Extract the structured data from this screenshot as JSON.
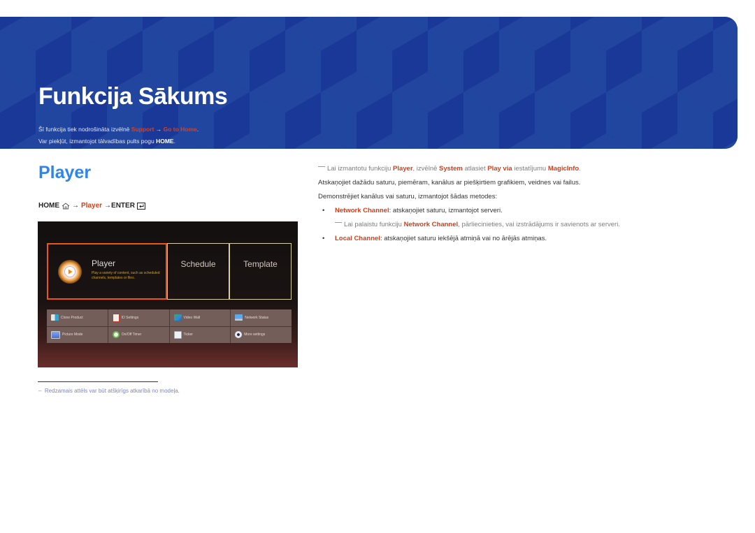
{
  "banner": {
    "title": "Funkcija Sākums",
    "line1": {
      "prefix": "Šī funkcija tiek nodrošināta izvēlnē ",
      "menu": "Support",
      "arrow": " → ",
      "item": "Go to Home",
      "suffix": "."
    },
    "line2": {
      "prefix": "Var piekļūt, izmantojot tālvadības pults pogu ",
      "key": "HOME",
      "suffix": "."
    }
  },
  "section": {
    "title": "Player",
    "path": {
      "home": "HOME",
      "home_icon": "home-icon",
      "arrow1": "→",
      "player": "Player",
      "arrow2": "→ENTER",
      "enter_icon": "enter-icon"
    }
  },
  "screenshot": {
    "tiles": {
      "player": {
        "title": "Player",
        "desc": "Play a variety of content, such as scheduled channels, templates or files.",
        "icon": "play-icon"
      },
      "schedule": {
        "title": "Schedule"
      },
      "template": {
        "title": "Template"
      }
    },
    "grid": [
      {
        "label": "Clone Product",
        "icon": "clone-product-icon"
      },
      {
        "label": "ID Settings",
        "icon": "id-settings-icon"
      },
      {
        "label": "Video Wall",
        "icon": "video-wall-icon"
      },
      {
        "label": "Network Status",
        "icon": "network-status-icon"
      },
      {
        "label": "Picture Mode",
        "icon": "picture-mode-icon"
      },
      {
        "label": "On/Off Timer",
        "icon": "on-off-timer-icon"
      },
      {
        "label": "Ticker",
        "icon": "ticker-icon"
      },
      {
        "label": "More settings",
        "icon": "more-settings-icon"
      }
    ]
  },
  "footnote": "Redzamais attēls var būt atšķirīgs atkarībā no modeļa.",
  "right": {
    "note1": {
      "p1": "Lai izmantotu funkciju ",
      "b1": "Player",
      "p2": ", izvēlnē ",
      "b2": "System",
      "p3": " atlasiet ",
      "b3": "Play via",
      "p4": " iestatījumu ",
      "b4": "MagicInfo",
      "p5": "."
    },
    "para1": "Atskaņojiet dažādu saturu, piemēram, kanālus ar piešķirtiem grafikiem, veidnes vai failus.",
    "para2": "Demonstrējiet kanālus vai saturu, izmantojot šādas metodes:",
    "bullets": [
      {
        "term": "Network Channel",
        "text": ": atskaņojiet saturu, izmantojot serveri."
      },
      {
        "term": "Local Channel",
        "text": ": atskaņojiet saturu iekšējā atmiņā vai no ārējās atmiņas."
      }
    ],
    "subnote": {
      "p1": "Lai palaistu funkciju ",
      "b1": "Network Channel",
      "p2": ", pārliecinieties, vai izstrādājums ir savienots ar serveri."
    }
  }
}
